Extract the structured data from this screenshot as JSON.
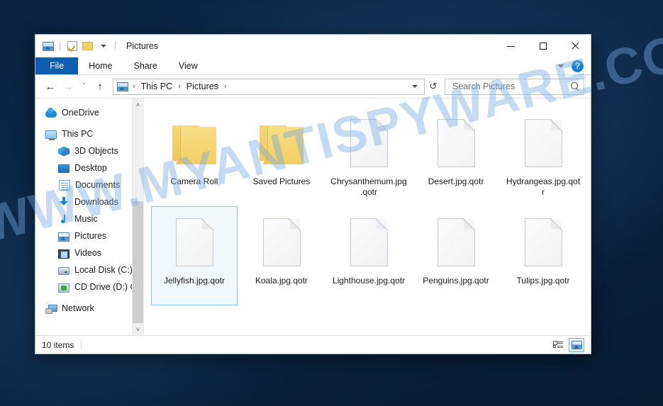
{
  "desktop": {
    "watermark": "WWW.MYANTISPYWARE.COM"
  },
  "window": {
    "title": "Pictures",
    "quick_access": [
      {
        "name": "pictures-icon",
        "label": "Pictures"
      },
      {
        "name": "properties-icon",
        "label": "Properties"
      },
      {
        "name": "new-folder-icon",
        "label": "New folder"
      },
      {
        "name": "customize-qat-caret",
        "label": "Customize Quick Access Toolbar"
      }
    ],
    "controls": {
      "minimize": "Minimize",
      "maximize": "Maximize",
      "close": "Close"
    }
  },
  "ribbon": {
    "tabs": [
      {
        "label": "File",
        "active": true
      },
      {
        "label": "Home",
        "active": false
      },
      {
        "label": "Share",
        "active": false
      },
      {
        "label": "View",
        "active": false
      }
    ],
    "expand_label": "Expand the Ribbon",
    "help_label": "?"
  },
  "addressbar": {
    "back": "←",
    "forward": "→",
    "recent": "ˇ",
    "up": "↑",
    "refresh": "↺",
    "breadcrumbs": [
      "This PC",
      "Pictures"
    ],
    "separator": "›",
    "dropdown": "Previous Locations"
  },
  "search": {
    "placeholder": "Search Pictures",
    "value": ""
  },
  "navpane": {
    "items": [
      {
        "label": "OneDrive",
        "icon": "ico-onedrive",
        "level": 0,
        "gap": false
      },
      {
        "label": "This PC",
        "icon": "ico-thispc",
        "level": 0,
        "gap": true
      },
      {
        "label": "3D Objects",
        "icon": "ico-3d",
        "level": 1,
        "gap": false
      },
      {
        "label": "Desktop",
        "icon": "ico-desktop",
        "level": 1,
        "gap": false
      },
      {
        "label": "Documents",
        "icon": "ico-documents",
        "level": 1,
        "gap": false
      },
      {
        "label": "Downloads",
        "icon": "ico-downloads",
        "level": 1,
        "gap": false
      },
      {
        "label": "Music",
        "icon": "ico-music",
        "level": 1,
        "gap": false
      },
      {
        "label": "Pictures",
        "icon": "ico-pictures",
        "level": 1,
        "gap": false
      },
      {
        "label": "Videos",
        "icon": "ico-videos",
        "level": 1,
        "gap": false
      },
      {
        "label": "Local Disk (C:)",
        "icon": "ico-disk",
        "level": 1,
        "gap": false
      },
      {
        "label": "CD Drive (D:) CC",
        "icon": "ico-cd",
        "level": 1,
        "gap": false
      },
      {
        "label": "Network",
        "icon": "ico-network",
        "level": 0,
        "gap": true
      }
    ],
    "scroll_up": "˄",
    "scroll_down": "˅"
  },
  "files": [
    {
      "name": "Camera Roll",
      "type": "folder",
      "selected": false
    },
    {
      "name": "Saved Pictures",
      "type": "folder",
      "selected": false
    },
    {
      "name": "Chrysanthemum.jpg.qotr",
      "type": "file",
      "selected": false
    },
    {
      "name": "Desert.jpg.qotr",
      "type": "file",
      "selected": false
    },
    {
      "name": "Hydrangeas.jpg.qotr",
      "type": "file",
      "selected": false
    },
    {
      "name": "Jellyfish.jpg.qotr",
      "type": "file",
      "selected": true
    },
    {
      "name": "Koala.jpg.qotr",
      "type": "file",
      "selected": false
    },
    {
      "name": "Lighthouse.jpg.qotr",
      "type": "file",
      "selected": false
    },
    {
      "name": "Penguins.jpg.qotr",
      "type": "file",
      "selected": false
    },
    {
      "name": "Tulips.jpg.qotr",
      "type": "file",
      "selected": false
    }
  ],
  "statusbar": {
    "item_count": "10 items",
    "view_details_label": "Details view",
    "view_large_icons_label": "Large icons view"
  },
  "colors": {
    "accent": "#0d5fae",
    "selection_border": "#8fc5e8",
    "selection_fill": "#f0f7fd",
    "folder": "#f2cf62",
    "help_blue": "#1581d6",
    "watermark": "#78aae1"
  }
}
